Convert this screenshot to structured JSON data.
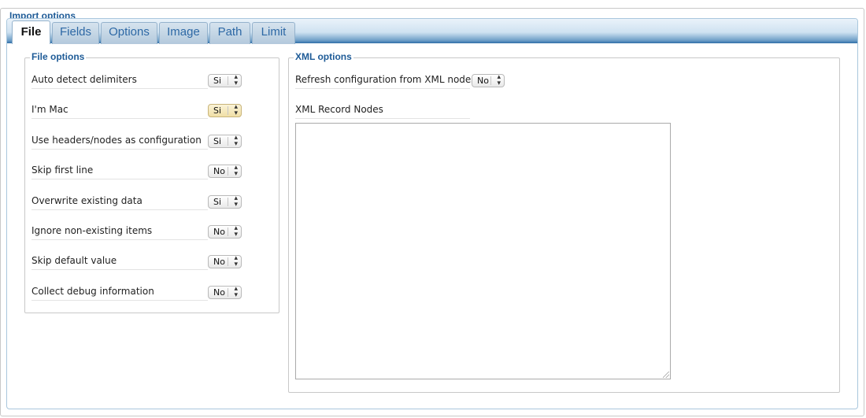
{
  "import_options": {
    "legend": "Import options"
  },
  "tabs": [
    {
      "label": "File",
      "active": true
    },
    {
      "label": "Fields",
      "active": false
    },
    {
      "label": "Options",
      "active": false
    },
    {
      "label": "Image",
      "active": false
    },
    {
      "label": "Path",
      "active": false
    },
    {
      "label": "Limit",
      "active": false
    }
  ],
  "file_options": {
    "legend": "File options",
    "rows": [
      {
        "label": "Auto detect delimiters",
        "value": "Si"
      },
      {
        "label": "I'm Mac",
        "value": "Si",
        "highlighted": true
      },
      {
        "label": "Use headers/nodes as configuration",
        "value": "Si"
      },
      {
        "label": "Skip first line",
        "value": "No"
      },
      {
        "label": "Overwrite existing data",
        "value": "Si"
      },
      {
        "label": "Ignore non-existing items",
        "value": "No"
      },
      {
        "label": "Skip default value",
        "value": "No"
      },
      {
        "label": "Collect debug information",
        "value": "No"
      }
    ]
  },
  "xml_options": {
    "legend": "XML options",
    "refresh_label": "Refresh configuration from XML nodes",
    "refresh_value": "No",
    "record_nodes_label": "XML Record Nodes",
    "record_nodes_value": ""
  },
  "icons": {
    "select_arrows": "up-down-arrows-icon",
    "resize": "resize-grip-icon"
  }
}
